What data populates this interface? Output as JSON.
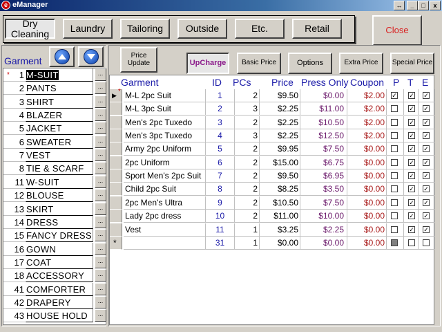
{
  "window": {
    "icon_letter": "e",
    "title": "eManager",
    "controls": [
      "↔",
      "_",
      "□",
      "x"
    ]
  },
  "categories": [
    "Dry Cleaning",
    "Laundry",
    "Tailoring",
    "Outside",
    "Etc.",
    "Retail"
  ],
  "close_label": "Close",
  "garment_panel": {
    "label": "Garment",
    "items": [
      {
        "num": "1",
        "name": "M-SUIT",
        "selected": true
      },
      {
        "num": "2",
        "name": "PANTS"
      },
      {
        "num": "3",
        "name": "SHIRT"
      },
      {
        "num": "4",
        "name": "BLAZER"
      },
      {
        "num": "5",
        "name": "JACKET"
      },
      {
        "num": "6",
        "name": "SWEATER"
      },
      {
        "num": "7",
        "name": "VEST"
      },
      {
        "num": "8",
        "name": "TIE & SCARF"
      },
      {
        "num": "11",
        "name": "W-SUIT"
      },
      {
        "num": "12",
        "name": "BLOUSE"
      },
      {
        "num": "13",
        "name": "SKIRT"
      },
      {
        "num": "14",
        "name": "DRESS"
      },
      {
        "num": "15",
        "name": "FANCY DRESS"
      },
      {
        "num": "16",
        "name": "GOWN"
      },
      {
        "num": "17",
        "name": "COAT"
      },
      {
        "num": "18",
        "name": "ACCESSORY"
      },
      {
        "num": "41",
        "name": "COMFORTER"
      },
      {
        "num": "42",
        "name": "DRAPERY"
      },
      {
        "num": "43",
        "name": "HOUSE HOLD"
      }
    ],
    "dots_label": "..."
  },
  "tabs": {
    "price_update": "Price Update",
    "upcharge": "UpCharge",
    "basic_price": "Basic Price",
    "options": "Options",
    "extra_price": "Extra Price",
    "special_price": "Special Price"
  },
  "grid": {
    "headers": {
      "garment": "Garment",
      "id": "ID",
      "pcs": "PCs",
      "price": "Price",
      "press_only": "Press Only",
      "coupon": "Coupon",
      "p": "P",
      "t": "T",
      "e": "E"
    },
    "rows": [
      {
        "garment": "M-L 2pc Suit",
        "id": "1",
        "pcs": "2",
        "price": "$9.50",
        "press_only": "$0.00",
        "coupon": "$2.00",
        "p": true,
        "t": true,
        "e": true
      },
      {
        "garment": "M-L 3pc Suit",
        "id": "2",
        "pcs": "3",
        "price": "$2.25",
        "press_only": "$11.00",
        "coupon": "$2.00",
        "p": false,
        "t": true,
        "e": true
      },
      {
        "garment": "Men's 2pc Tuxedo",
        "id": "3",
        "pcs": "2",
        "price": "$2.25",
        "press_only": "$10.50",
        "coupon": "$2.00",
        "p": false,
        "t": true,
        "e": true
      },
      {
        "garment": "Men's 3pc Tuxedo",
        "id": "4",
        "pcs": "3",
        "price": "$2.25",
        "press_only": "$12.50",
        "coupon": "$2.00",
        "p": false,
        "t": true,
        "e": true
      },
      {
        "garment": "Army 2pc Uniform",
        "id": "5",
        "pcs": "2",
        "price": "$9.95",
        "press_only": "$7.50",
        "coupon": "$0.00",
        "p": false,
        "t": true,
        "e": true
      },
      {
        "garment": "2pc Uniform",
        "id": "6",
        "pcs": "2",
        "price": "$15.00",
        "press_only": "$6.75",
        "coupon": "$0.00",
        "p": false,
        "t": true,
        "e": true
      },
      {
        "garment": "Sport Men's 2pc Suit",
        "id": "7",
        "pcs": "2",
        "price": "$9.50",
        "press_only": "$6.95",
        "coupon": "$0.00",
        "p": false,
        "t": true,
        "e": true
      },
      {
        "garment": "Child 2pc Suit",
        "id": "8",
        "pcs": "2",
        "price": "$8.25",
        "press_only": "$3.50",
        "coupon": "$0.00",
        "p": false,
        "t": true,
        "e": true
      },
      {
        "garment": "2pc Men's  Ultra",
        "id": "9",
        "pcs": "2",
        "price": "$10.50",
        "press_only": "$7.50",
        "coupon": "$0.00",
        "p": false,
        "t": true,
        "e": true
      },
      {
        "garment": "Lady 2pc dress",
        "id": "10",
        "pcs": "2",
        "price": "$11.00",
        "press_only": "$10.00",
        "coupon": "$0.00",
        "p": false,
        "t": true,
        "e": true
      },
      {
        "garment": "Vest",
        "id": "11",
        "pcs": "1",
        "price": "$3.25",
        "press_only": "$2.25",
        "coupon": "$0.00",
        "p": false,
        "t": true,
        "e": true
      }
    ],
    "new_row": {
      "id": "31",
      "pcs": "1",
      "price": "$0.00",
      "press_only": "$0.00",
      "coupon": "$0.00"
    },
    "new_row_marker": "*",
    "current_row_marker": "▶"
  },
  "colors": {
    "close_text": "#d81e1e",
    "upcharge_text": "#8b1a8b",
    "header_text": "#1a1aa8"
  },
  "icons": {
    "up": "up-arrow-icon",
    "down": "down-arrow-icon"
  }
}
